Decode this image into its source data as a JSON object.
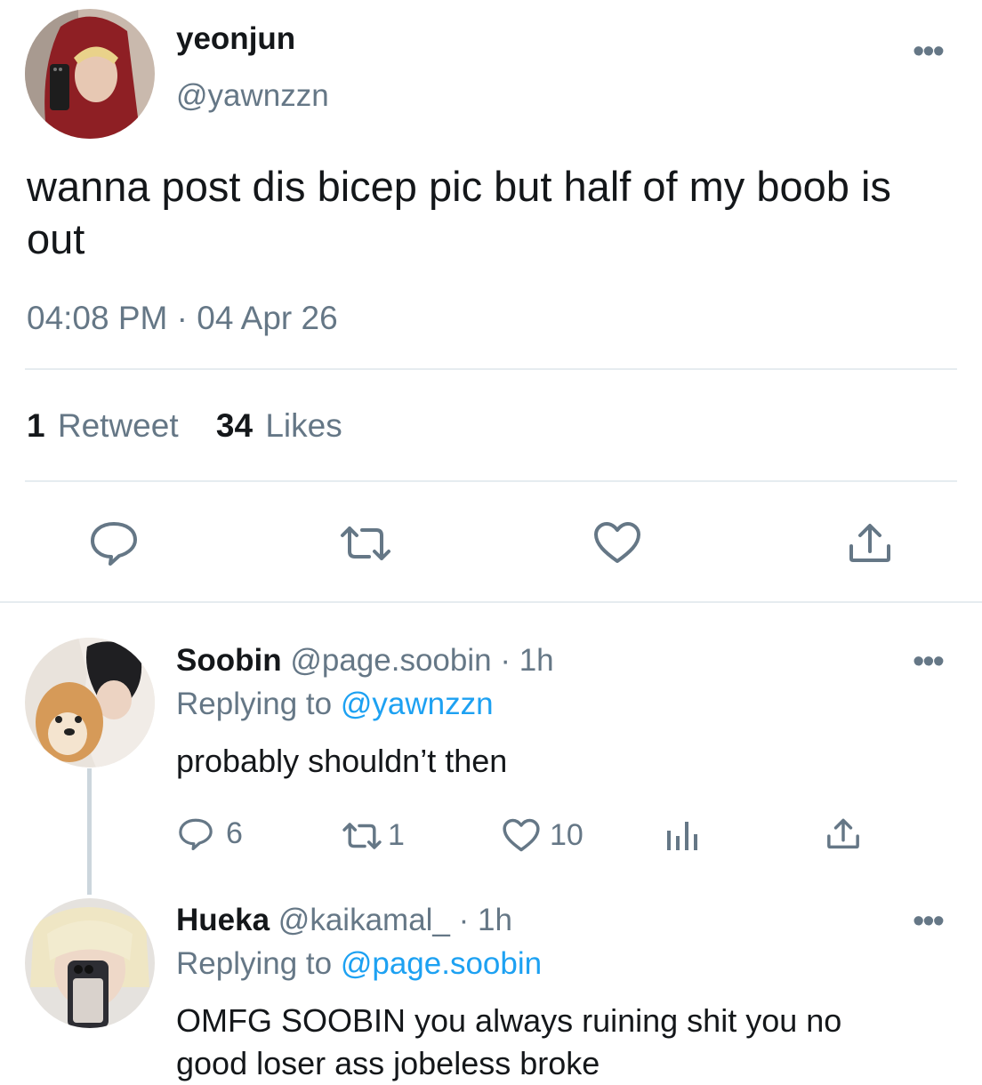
{
  "main_tweet": {
    "display_name": "yeonjun",
    "handle": "@yawnzzn",
    "text": "wanna post dis bicep pic but half of my boob is out",
    "timestamp": "04:08 PM · 04 Apr 26",
    "stats": {
      "retweets_count": "1",
      "retweets_label": "Retweet",
      "likes_count": "34",
      "likes_label": "Likes"
    },
    "actions": [
      "reply-icon",
      "retweet-icon",
      "heart-icon",
      "share-icon"
    ]
  },
  "replies": [
    {
      "display_name": "Soobin",
      "handle": "@page.soobin",
      "age": "· 1h",
      "replying_prefix": "Replying to",
      "replying_handle": "@yawnzzn",
      "text": "probably shouldn’t then",
      "reply_count": "6",
      "retweet_count": "1",
      "like_count": "10"
    },
    {
      "display_name": "Hueka",
      "handle": "@kaikamal_",
      "age": "· 1h",
      "replying_prefix": "Replying to",
      "replying_handle": "@page.soobin",
      "text_line1": "OMFG SOOBIN you always ruining shit you no",
      "text_line2": "good loser ass jobeless broke"
    }
  ],
  "colors": {
    "link": "#1da1f2",
    "secondary_text": "#657786",
    "divider": "#e6ecf0",
    "thread_line": "#ccd6dd"
  }
}
